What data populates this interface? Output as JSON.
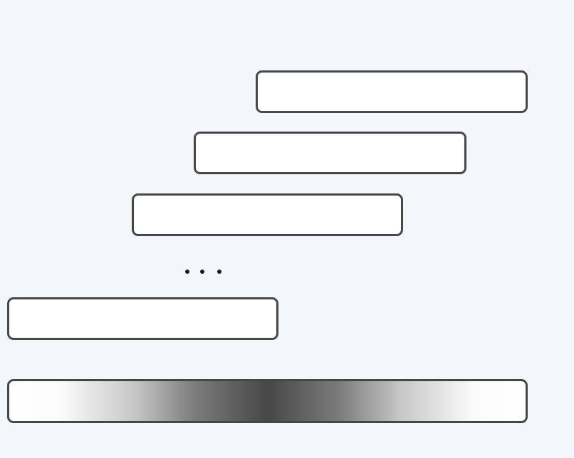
{
  "diagram": {
    "boxes": [
      {
        "id": "box-1",
        "label": ""
      },
      {
        "id": "box-2",
        "label": ""
      },
      {
        "id": "box-3",
        "label": ""
      },
      {
        "id": "box-4",
        "label": ""
      }
    ],
    "ellipsis": "…",
    "gradient_bar": {
      "label": "",
      "colors": [
        "#ffffff",
        "#474747",
        "#ffffff"
      ]
    },
    "colors": {
      "background": "#f3f6fa",
      "box_border": "#474747",
      "box_fill": "#ffffff"
    }
  }
}
